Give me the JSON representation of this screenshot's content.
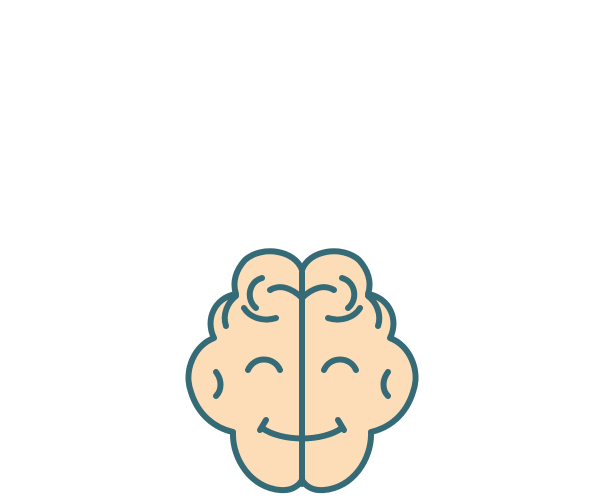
{
  "scene": {
    "background": "#ffffff"
  },
  "illustration": {
    "icon": "smiling-brain-icon",
    "fill_color": "#FDDDB7",
    "stroke_color": "#356A77"
  }
}
